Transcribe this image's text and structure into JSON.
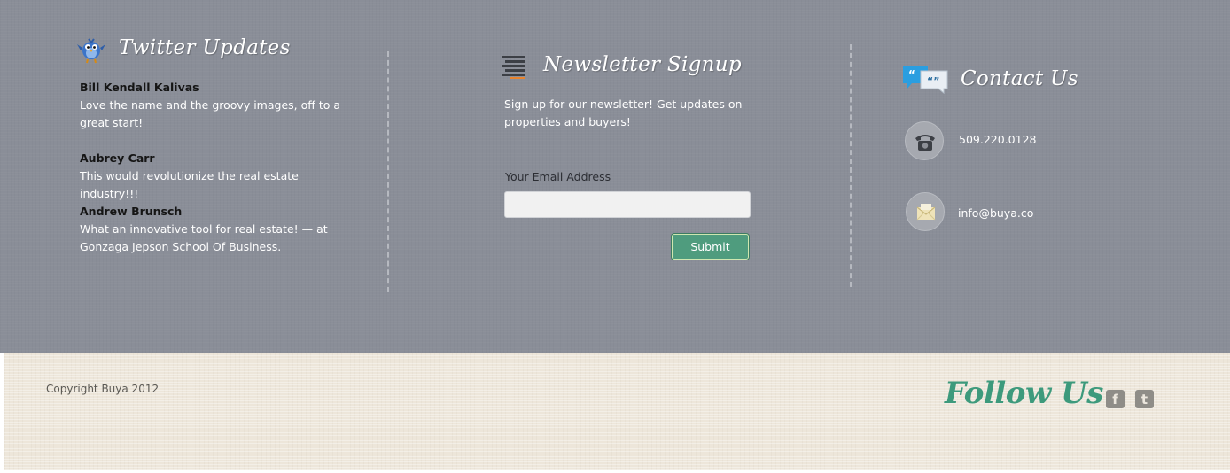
{
  "twitter": {
    "heading": "Twitter Updates",
    "items": [
      {
        "name": "Bill Kendall Kalivas",
        "text": "Love the name and the groovy images, off to a great start!"
      },
      {
        "name": "Aubrey Carr",
        "text": "This would revolutionize the real estate industry!!!"
      },
      {
        "name": "Andrew Brunsch",
        "text": "What an innovative tool for real estate! — at Gonzaga Jepson School Of Business."
      }
    ]
  },
  "newsletter": {
    "heading": "Newsletter Signup",
    "description": "Sign up for our newsletter! Get updates on properties and buyers!",
    "email_label": "Your Email Address",
    "email_value": "",
    "submit_label": "Submit"
  },
  "contact": {
    "heading": "Contact Us",
    "phone": "509.220.0128",
    "email": "info@buya.co"
  },
  "footer": {
    "copyright": "Copyright Buya 2012",
    "follow_heading": "Follow Us",
    "social": [
      {
        "glyph": "f",
        "icon": "facebook-icon"
      },
      {
        "glyph": "t",
        "icon": "twitter-icon"
      }
    ]
  },
  "colors": {
    "top_bg": "#8a8e98",
    "bottom_bg": "#ede6da",
    "accent_green": "#3d9a7c",
    "submit_bg": "#4f9c7e"
  }
}
